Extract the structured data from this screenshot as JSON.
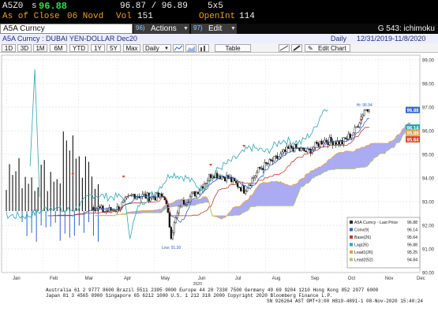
{
  "quote": {
    "ticker": "A5Z0",
    "last_prefix": "s",
    "last_price": "96.88",
    "bid_ask": "96.87 / 96.89",
    "size": "5x5",
    "as_of_label": "As of Close",
    "as_of_date": "06 Novd",
    "vol_label": "Vol",
    "vol_value": "151",
    "open_int_label": "OpenInt",
    "open_int_value": "114"
  },
  "toolbar": {
    "security_field": "A5A Curncy",
    "actions_num": "96)",
    "actions_label": "Actions",
    "edit_num": "97)",
    "edit_label": "Edit",
    "function_label": "G 543: ichimoku"
  },
  "security_line": {
    "description": "A5A Curncy : DUBAI YEN-DOLLAR Dec20",
    "periodicity": "Daily",
    "date_range": "12/31/2019-11/8/2020"
  },
  "buttons": {
    "periods": [
      "1D",
      "3D",
      "1M",
      "6M",
      "YTD",
      "1Y",
      "5Y",
      "Max"
    ],
    "freq": "Daily",
    "table": "Table",
    "edit_chart": "Edit Chart"
  },
  "chart_data": {
    "type": "candlestick",
    "ylim": [
      90.0,
      99.2
    ],
    "y_ticks": [
      "99.00",
      "98.00",
      "97.00",
      "96.00",
      "95.00",
      "94.00",
      "93.00",
      "92.00",
      "91.00",
      "90.00"
    ],
    "x_labels": [
      "Jan",
      "Feb",
      "Mar",
      "Apr",
      "May",
      "Jun",
      "Jul",
      "Aug",
      "Sep",
      "Oct",
      "Nov",
      "Dec"
    ],
    "year_label": "2020",
    "hi_annotation": "Hi: 96.94",
    "low_annotation": "Low: 91.30",
    "hi": 96.94,
    "low": 91.3,
    "price_tags": [
      {
        "value": "96.88",
        "color": "#2f63c8"
      },
      {
        "value": "96.14",
        "color": "#2aa5b0"
      },
      {
        "value": "95.89",
        "color": "#e0a050"
      },
      {
        "value": "95.64",
        "color": "#d8402a"
      }
    ],
    "series": [
      {
        "name": "A5A Curncy - Last Price",
        "value": "96.88",
        "color": "#2b2b2b"
      },
      {
        "name": "Conv(9)",
        "value": "96.14",
        "color": "#2f63c8"
      },
      {
        "name": "Base(26)",
        "value": "95.64",
        "color": "#c0392b"
      },
      {
        "name": "Lag(26)",
        "value": "96.88",
        "color": "#2aa5b0"
      },
      {
        "name": "Lead1(26)",
        "value": "95.25",
        "color": "#e8a040"
      },
      {
        "name": "Lead2(52)",
        "value": "94.84",
        "color": "#a7c95e"
      }
    ],
    "grid": true,
    "legend_position": "bottom-right"
  },
  "footer": {
    "line1": "Australia 61 2 9777 8600 Brazil 5511 2395 9000 Europe 44 20 7330 7500 Germany 49 69 9204 1210 Hong Kong 852 2977 6000",
    "line2": "Japan 81 3 4565 8900        Singapore 65 6212 1000        U.S. 1 212 318 2000        Copyright 2020 Bloomberg Finance L.P.",
    "line3": "SN 926264 AST  GMT+3:00 H819-4891-1 08-Nov-2020 15:40:24"
  }
}
